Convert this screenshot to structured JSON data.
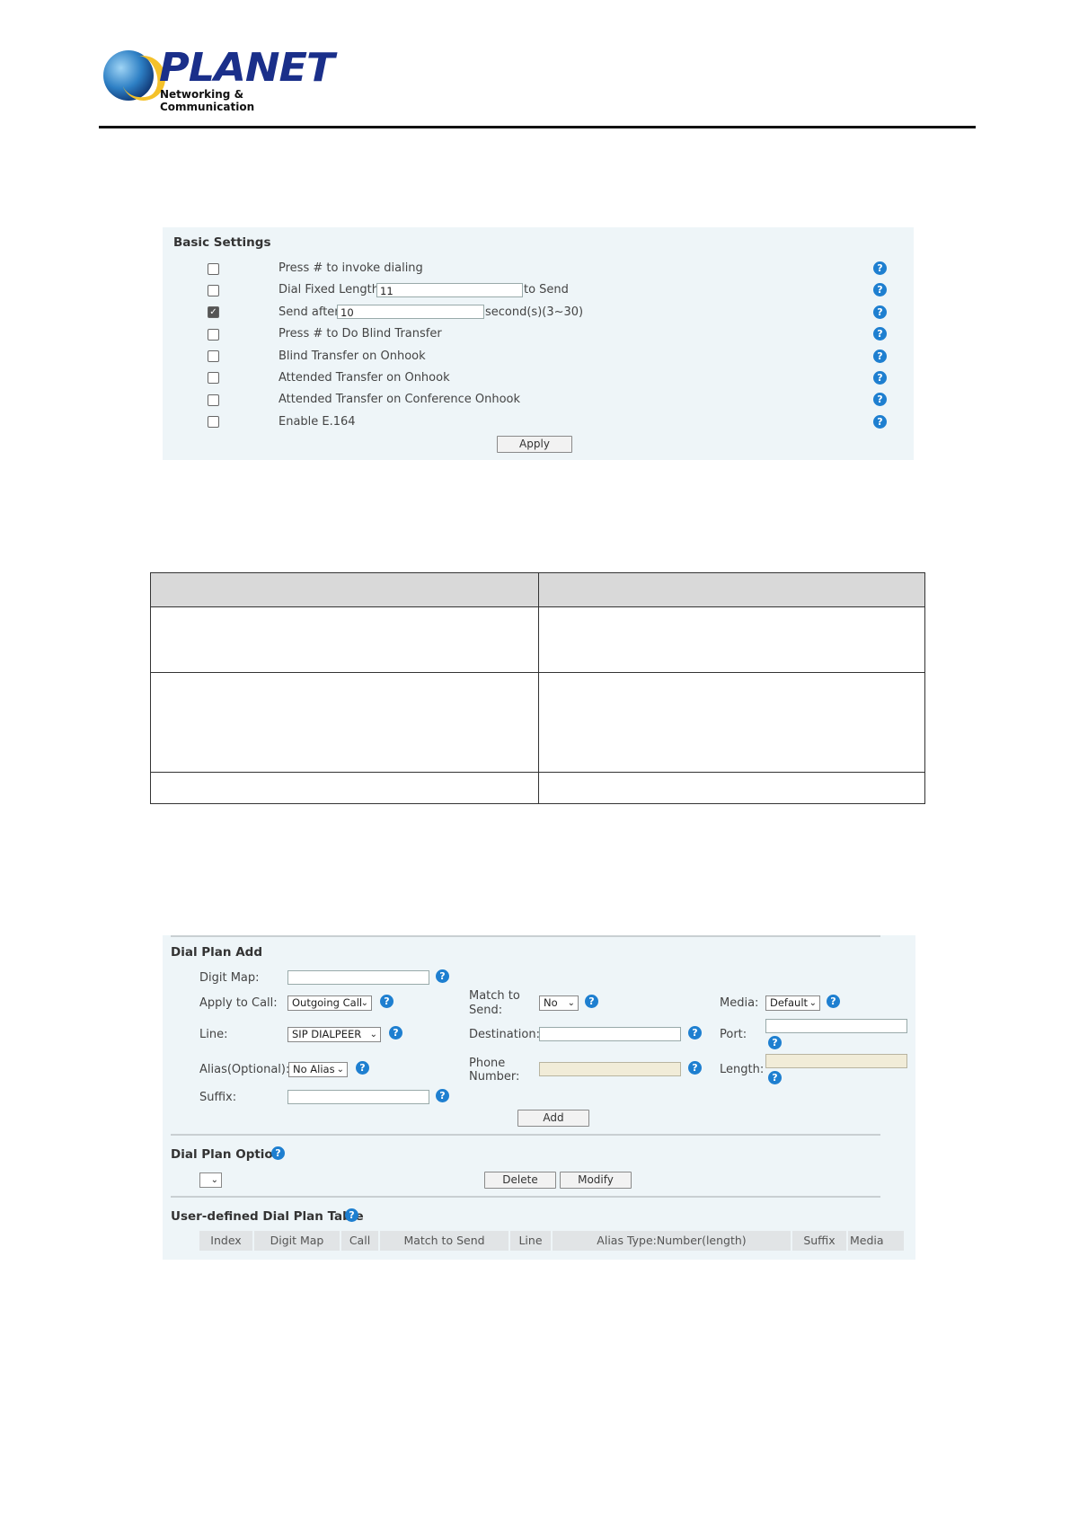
{
  "header": {
    "logo_text": "PLANET",
    "logo_subtitle": "Networking & Communication"
  },
  "basic_settings": {
    "title": "Basic Settings",
    "rows": [
      {
        "label": "Press # to invoke dialing",
        "checked": false
      },
      {
        "label": "Dial Fixed Length",
        "value": "11",
        "suffix": "to Send",
        "checked": false
      },
      {
        "label": "Send after",
        "value": "10",
        "suffix": "second(s)(3~30)",
        "checked": true
      },
      {
        "label": "Press # to Do Blind Transfer",
        "checked": false
      },
      {
        "label": "Blind Transfer on Onhook",
        "checked": false
      },
      {
        "label": "Attended Transfer on Onhook",
        "checked": false
      },
      {
        "label": "Attended Transfer on Conference Onhook",
        "checked": false
      },
      {
        "label": "Enable E.164",
        "checked": false
      }
    ],
    "apply_label": "Apply"
  },
  "dial_plan_add": {
    "title": "Dial Plan Add",
    "digit_map_label": "Digit Map:",
    "digit_map_value": "",
    "apply_to_call_label": "Apply to Call:",
    "apply_to_call_value": "Outgoing Call",
    "match_to_send_label_1": "Match to",
    "match_to_send_label_2": "Send:",
    "match_to_send_value": "No",
    "media_label": "Media:",
    "media_value": "Default",
    "line_label": "Line:",
    "line_value": "SIP DIALPEER",
    "destination_label": "Destination:",
    "destination_value": "",
    "port_label": "Port:",
    "port_value": "",
    "alias_label": "Alias(Optional):",
    "alias_value": "No Alias",
    "phone_number_label_1": "Phone",
    "phone_number_label_2": "Number:",
    "phone_number_value": "",
    "length_label": "Length:",
    "length_value": "",
    "suffix_label": "Suffix:",
    "suffix_value": "",
    "add_label": "Add"
  },
  "dial_plan_option": {
    "title": "Dial Plan Option",
    "select_value": "",
    "delete_label": "Delete",
    "modify_label": "Modify"
  },
  "user_table": {
    "title": "User-defined Dial Plan Table",
    "columns": [
      "Index",
      "Digit Map",
      "Call",
      "Match to Send",
      "Line",
      "Alias Type:Number(length)",
      "Suffix",
      "Media"
    ]
  },
  "help_glyph": "?"
}
